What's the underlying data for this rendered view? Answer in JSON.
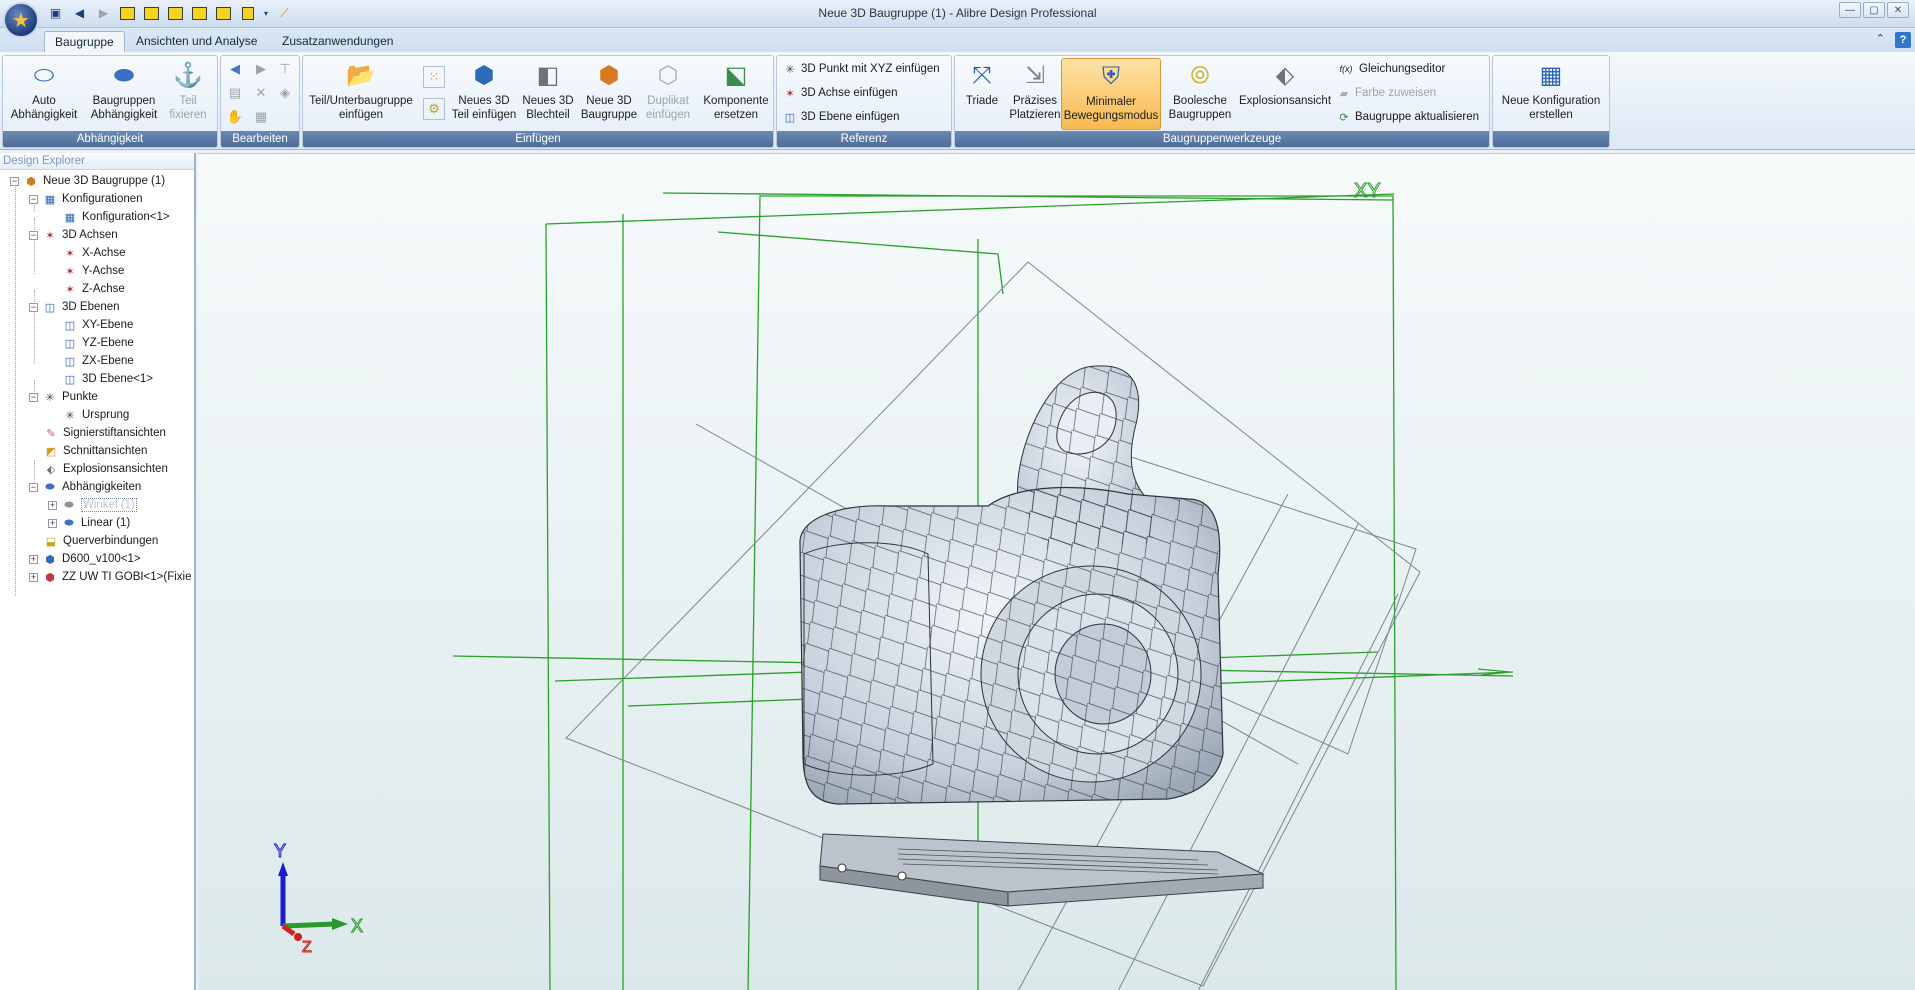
{
  "window": {
    "title": "Neue 3D Baugruppe (1) - Alibre Design Professional",
    "minimize": "—",
    "maximize": "▢",
    "close": "✕"
  },
  "tabs": [
    "Baugruppe",
    "Ansichten und Analyse",
    "Zusatzanwendungen"
  ],
  "help": "?",
  "ribbon": {
    "groups": {
      "abhaengigkeit": "Abhängigkeit",
      "bearbeiten": "Bearbeiten",
      "einfuegen": "Einfügen",
      "referenz": "Referenz",
      "werkzeuge": "Baugruppenwerkzeuge"
    },
    "buttons": {
      "auto_line1": "Auto",
      "auto_line2": "Abhängigkeit",
      "bg_line1": "Baugruppen",
      "bg_line2": "Abhängigkeit",
      "teil_line1": "Teil",
      "teil_line2": "fixieren",
      "unter_line1": "Teil/Unterbaugruppe",
      "unter_line2": "einfügen",
      "neu3d_line1": "Neues 3D",
      "neu3d_line2": "Teil einfügen",
      "blech_line1": "Neues 3D",
      "blech_line2": "Blechteil",
      "baugr_line1": "Neue 3D",
      "baugr_line2": "Baugruppe",
      "dup_line1": "Duplikat",
      "dup_line2": "einfügen",
      "komp_line1": "Komponente",
      "komp_line2": "ersetzen",
      "punkt": "3D Punkt mit XYZ einfügen",
      "achse": "3D Achse einfügen",
      "ebene": "3D Ebene einfügen",
      "triade": "Triade",
      "praez_line1": "Präzises",
      "praez_line2": "Platzieren",
      "min_line1": "Minimaler",
      "min_line2": "Bewegungsmodus",
      "bool_line1": "Boolesche",
      "bool_line2": "Baugruppen",
      "explosion": "Explosionsansicht",
      "gleichung_prefix": "f(x)",
      "gleichung": "Gleichungseditor",
      "farbe": "Farbe zuweisen",
      "aktualisieren": "Baugruppe aktualisieren",
      "konf_line1": "Neue Konfiguration",
      "konf_line2": "erstellen"
    }
  },
  "explorer": {
    "title": "Design Explorer",
    "nodes": [
      "Neue 3D Baugruppe (1)",
      "Konfigurationen",
      "Konfiguration<1>",
      "3D Achsen",
      "X-Achse",
      "Y-Achse",
      "Z-Achse",
      "3D Ebenen",
      "XY-Ebene",
      "YZ-Ebene",
      "ZX-Ebene",
      "3D Ebene<1>",
      "Punkte",
      "Ursprung",
      "Signierstiftansichten",
      "Schnittansichten",
      "Explosionsansichten",
      "Abhängigkeiten",
      "Winkel (1)",
      "Linear (1)",
      "Querverbindungen",
      "D600_v100<1>",
      "ZZ UW TI GOBI<1>(Fixie"
    ]
  },
  "viewport": {
    "plane_label": "XY",
    "axis_y": "Y",
    "axis_x": "X",
    "axis_z": "Z"
  }
}
